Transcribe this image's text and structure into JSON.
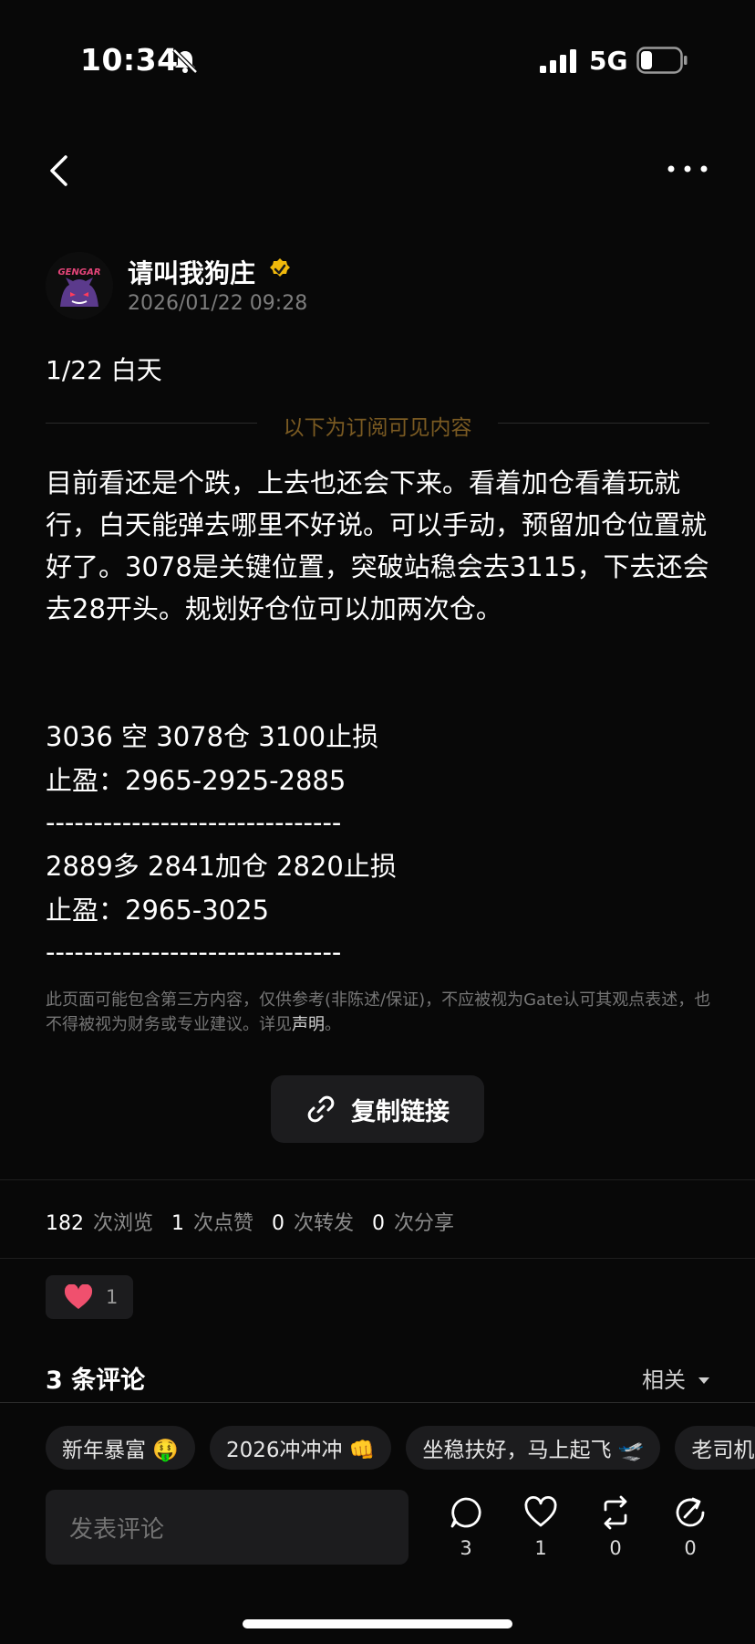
{
  "status_bar": {
    "time": "10:34",
    "network": "5G"
  },
  "author": {
    "name": "请叫我狗庄",
    "time": "2026/01/22 09:28",
    "avatar_text": "GENGAR"
  },
  "post": {
    "title": "1/22 白天",
    "subscriber_label": "以下为订阅可见内容",
    "body_paragraph": "目前看还是个跌，上去也还会下来。看着加仓看着玩就行，白天能弹去哪里不好说。可以手动，预留加仓位置就好了。3078是关键位置，突破站稳会去3115，下去还会去28开头。规划好仓位可以加两次仓。",
    "lines": [
      "3036 空 3078仓 3100止损",
      "止盈：2965-2925-2885",
      "-------------------------------",
      "2889多 2841加仓 2820止损",
      "止盈：2965-3025",
      "-------------------------------"
    ]
  },
  "disclaimer": {
    "text": "此页面可能包含第三方内容，仅供参考(非陈述/保证)，不应被视为Gate认可其观点表述，也不得被视为财务或专业建议。详见",
    "link": "声明",
    "end": "。"
  },
  "copy_link_label": "复制链接",
  "stats": [
    {
      "value": "182",
      "label": "次浏览"
    },
    {
      "value": "1",
      "label": "次点赞"
    },
    {
      "value": "0",
      "label": "次转发"
    },
    {
      "value": "0",
      "label": "次分享"
    }
  ],
  "reaction": {
    "count": "1"
  },
  "comments": {
    "title": "3 条评论",
    "sort": "相关"
  },
  "quick_replies": [
    "新年暴富 🤑",
    "2026冲冲冲 👊",
    "坐稳扶好，马上起飞 🛫",
    "老司机"
  ],
  "comment_placeholder": "发表评论",
  "actions": [
    {
      "icon": "comment-icon",
      "count": "3"
    },
    {
      "icon": "heart-icon",
      "count": "1"
    },
    {
      "icon": "repost-icon",
      "count": "0"
    },
    {
      "icon": "share-icon",
      "count": "0"
    }
  ],
  "colors": {
    "background": "#080808",
    "accent": "#7a5a22",
    "verified": "#f0b90b",
    "heart": "#f0506e"
  }
}
